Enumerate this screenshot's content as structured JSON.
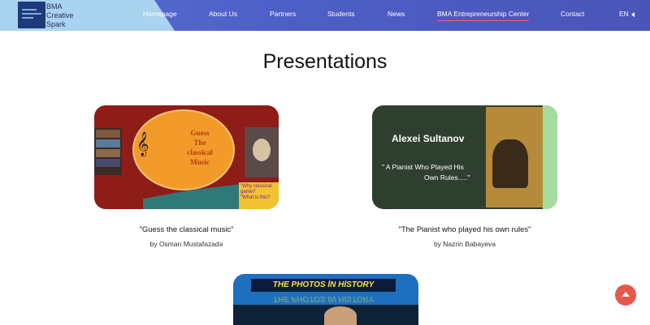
{
  "header": {
    "logo_lines": [
      "BMA",
      "Creative",
      "Spark"
    ],
    "nav": [
      "Homepage",
      "About Us",
      "Partners",
      "Students",
      "News",
      "BMA Entrepreneurship Center",
      "Contact"
    ],
    "language": "EN",
    "active_nav": "BMA Entrepreneurship Center"
  },
  "main": {
    "title": "Presentations",
    "cards": [
      {
        "title": "\"Guess the classical music\"",
        "author": "by Osman Mustafazadə",
        "image_text": [
          "Guess",
          "The",
          "classical",
          "Music"
        ],
        "image_note": [
          "\"Why classical",
          "game?",
          "\"What is this?"
        ]
      },
      {
        "title": "\"The Pianist who played his own rules\"",
        "author": "by Nazrin Babayeva",
        "image_name": "Alexei Sultanov",
        "image_quote": [
          "\" A Pianist Who Played   His",
          "Own Rules.....\""
        ]
      },
      {
        "banner": "THE PHOTOS İN HİSTORY"
      }
    ]
  },
  "scroll_top": {
    "icon": "arrow-up-icon",
    "color": "#e8574b"
  }
}
